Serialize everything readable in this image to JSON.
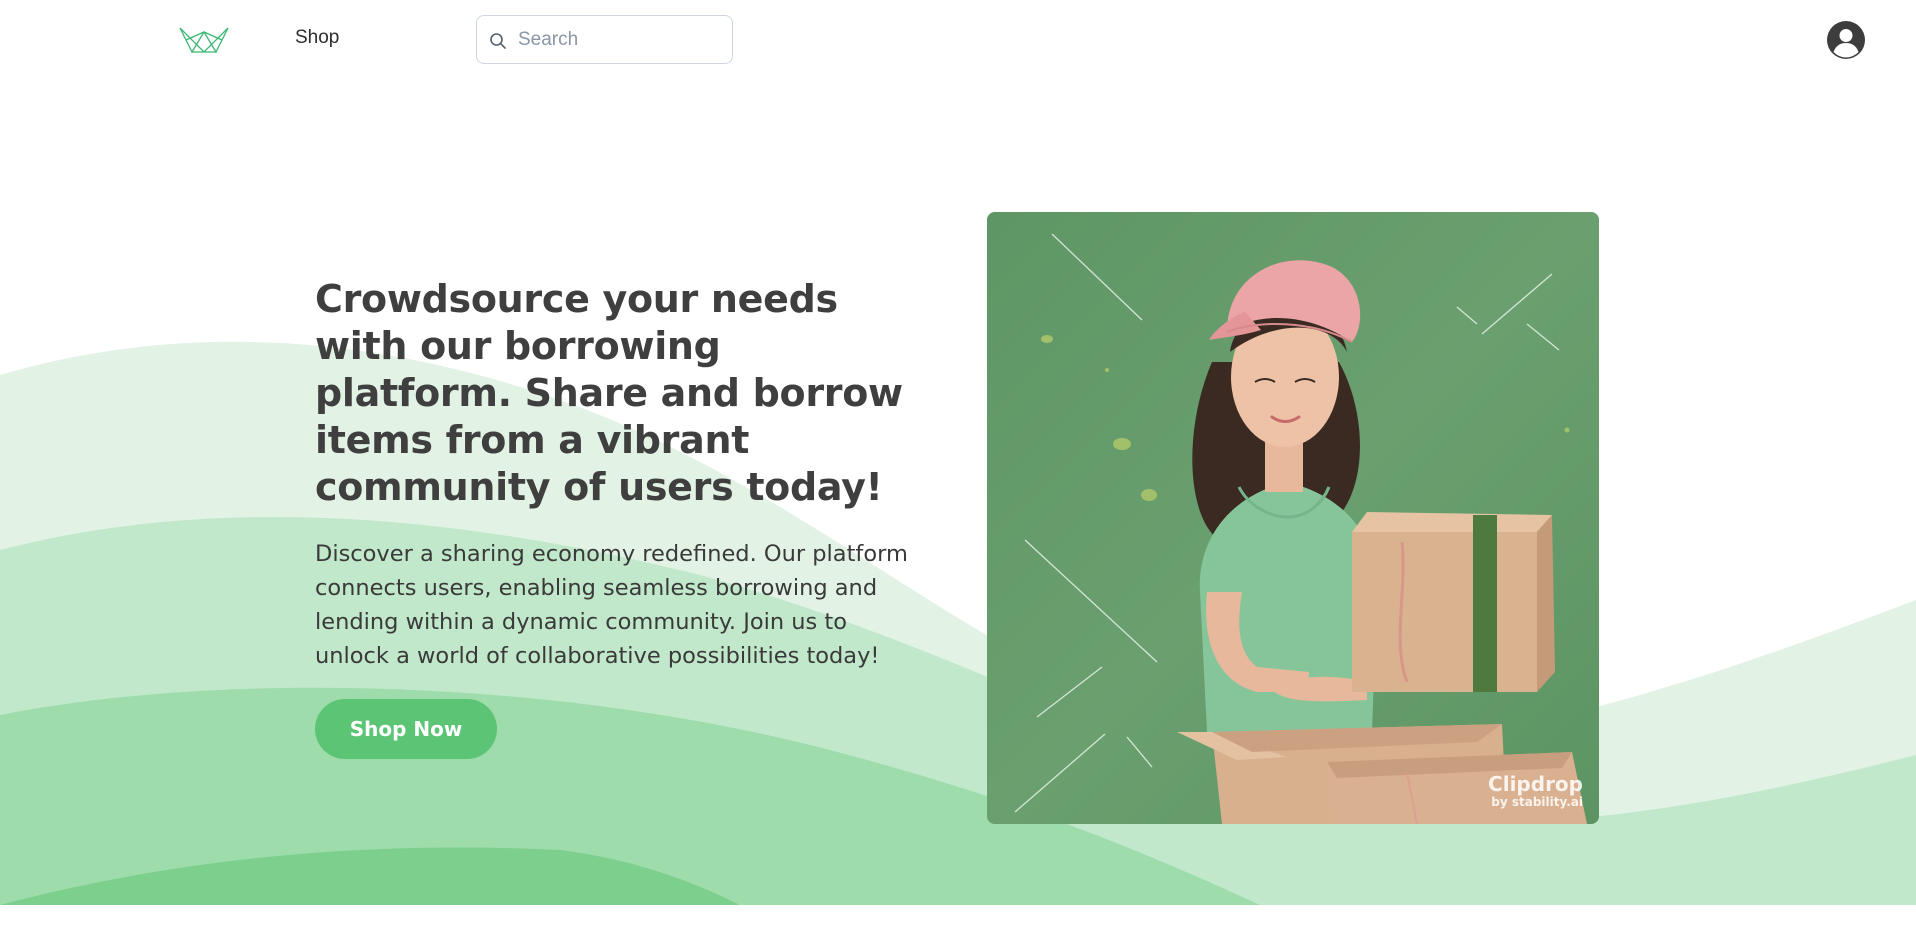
{
  "header": {
    "logo_icon": "crown-logo-icon",
    "nav_shop": "Shop",
    "search": {
      "icon": "search-icon",
      "placeholder": "Search",
      "value": ""
    },
    "profile_icon": "user-avatar-icon"
  },
  "hero": {
    "title": "Crowdsource your needs with our borrowing platform. Share and borrow items from a vibrant community of users today!",
    "description": "Discover a sharing economy redefined. Our platform connects users, enabling seamless borrowing and lending within a dynamic community. Join us to unlock a world of collaborative possibilities today!",
    "cta_label": "Shop Now",
    "image_watermark_main": "Clipdrop",
    "image_watermark_sub": "by stability.ai"
  },
  "colors": {
    "accent": "#5cc475",
    "wave_light": "#e2f3e6",
    "wave_mid": "#c1e8cb",
    "wave_strong": "#9edcab",
    "wave_deep": "#7ccf8d",
    "image_bg": "#669e6c",
    "heading": "#3f3f3f"
  }
}
